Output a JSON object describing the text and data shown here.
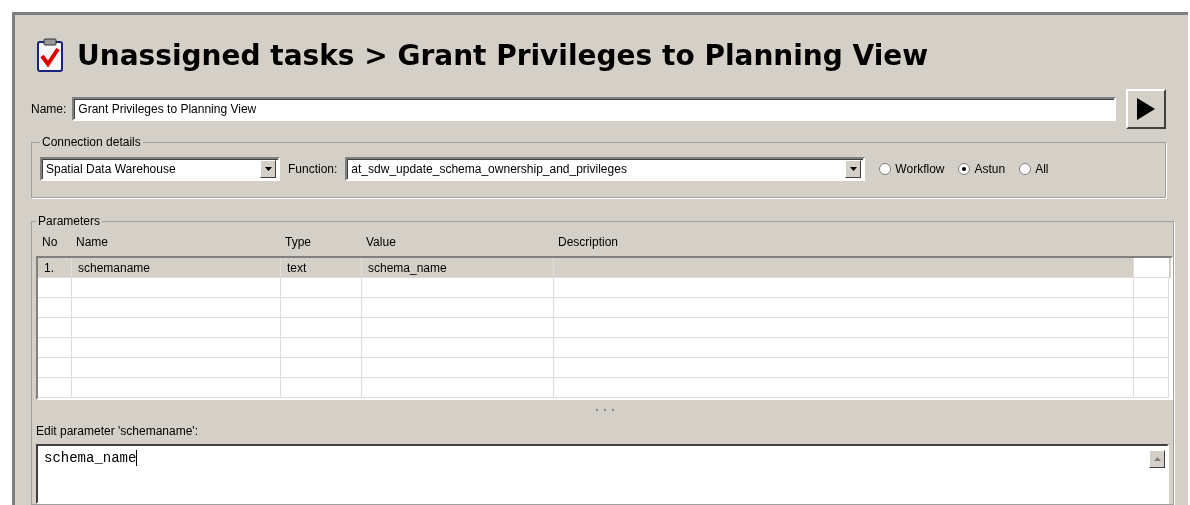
{
  "header": {
    "title": "Unassigned tasks > Grant Privileges to Planning View"
  },
  "name_field": {
    "label": "Name:",
    "value": "Grant Privileges to Planning View"
  },
  "connection": {
    "legend": "Connection details",
    "connection_value": "Spatial Data Warehouse",
    "function_label": "Function:",
    "function_value": "at_sdw_update_schema_ownership_and_privileges",
    "filter_options": [
      {
        "label": "Workflow",
        "selected": false
      },
      {
        "label": "Astun",
        "selected": true
      },
      {
        "label": "All",
        "selected": false
      }
    ]
  },
  "parameters": {
    "legend": "Parameters",
    "columns": [
      "No",
      "Name",
      "Type",
      "Value",
      "Description"
    ],
    "rows": [
      {
        "cells": [
          "1.",
          "schemaname",
          "text",
          "schema_name",
          ""
        ],
        "selected": true
      }
    ]
  },
  "editor": {
    "label": "Edit parameter 'schemaname':",
    "value": "schema_name"
  }
}
